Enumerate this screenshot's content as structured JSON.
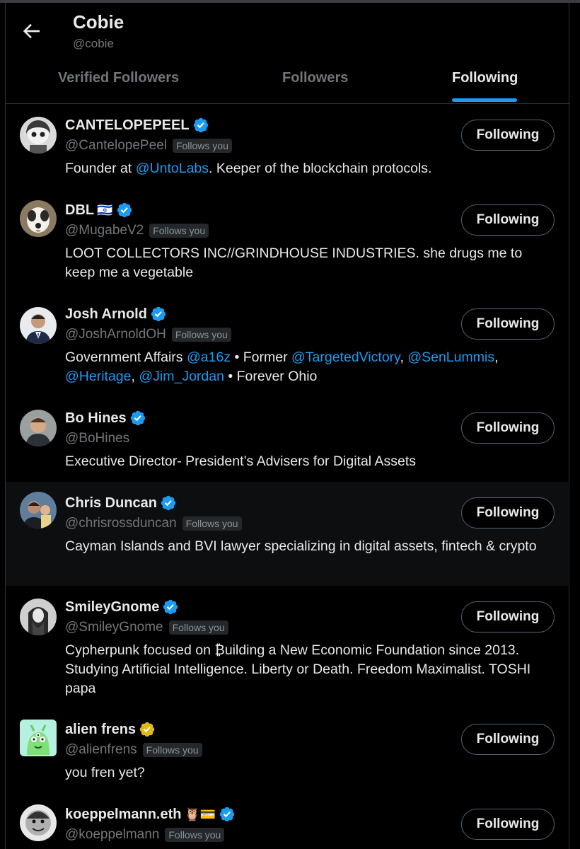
{
  "header": {
    "title": "Cobie",
    "handle": "@cobie",
    "tabs": [
      {
        "label": "Verified Followers"
      },
      {
        "label": "Followers"
      },
      {
        "label": "Following"
      }
    ]
  },
  "users": [
    {
      "name": "CANTELOPEPEEL",
      "handle": "@CantelopePeel",
      "follows_you": "Follows you",
      "button": "Following",
      "bio": [
        {
          "t": "Founder at "
        },
        {
          "link": "@UntoLabs"
        },
        {
          "t": ". Keeper of the blockchain protocols."
        }
      ]
    },
    {
      "name": "DBL",
      "emoji": "🇮🇱",
      "handle": "@MugabeV2",
      "follows_you": "Follows you",
      "button": "Following",
      "bio": [
        {
          "t": "LOOT COLLECTORS INC//GRINDHOUSE INDUSTRIES. she drugs me to keep me a vegetable"
        }
      ]
    },
    {
      "name": "Josh Arnold",
      "handle": "@JoshArnoldOH",
      "follows_you": "Follows you",
      "button": "Following",
      "bio": [
        {
          "t": "Government Affairs "
        },
        {
          "link": "@a16z"
        },
        {
          "t": " • Former "
        },
        {
          "link": "@TargetedVictory"
        },
        {
          "t": ", "
        },
        {
          "link": "@SenLummis"
        },
        {
          "t": ", "
        },
        {
          "link": "@Heritage"
        },
        {
          "t": ", "
        },
        {
          "link": "@Jim_Jordan"
        },
        {
          "t": " • Forever Ohio"
        }
      ]
    },
    {
      "name": "Bo Hines",
      "handle": "@BoHines",
      "follows_you": "",
      "button": "Following",
      "bio": [
        {
          "t": "Executive Director- President’s Advisers for Digital Assets"
        }
      ]
    },
    {
      "name": "Chris Duncan",
      "handle": "@chrisrossduncan",
      "follows_you": "Follows you",
      "button": "Following",
      "bio": [
        {
          "t": "Cayman Islands and BVI lawyer specializing in digital assets, fintech & crypto"
        }
      ]
    },
    {
      "name": "SmileyGnome",
      "handle": "@SmileyGnome",
      "follows_you": "Follows you",
      "button": "Following",
      "bio": [
        {
          "t": "Cypherpunk focused on ₿uilding a New Economic Foundation since 2013. Studying Artificial Intelligence. Liberty or Death. Freedom Maximalist. TOSHI papa"
        }
      ]
    },
    {
      "name": "alien frens",
      "handle": "@alienfrens",
      "follows_you": "Follows you",
      "button": "Following",
      "badge": "gold",
      "bio": [
        {
          "t": "you fren yet?"
        }
      ]
    },
    {
      "name": "koeppelmann.eth",
      "emoji": "🦉💳",
      "handle": "@koeppelmann",
      "follows_you": "Follows you",
      "button": "Following",
      "bio": []
    }
  ],
  "colors": {
    "accent": "#1d9bf0",
    "verified": "#1d9bf0",
    "gold": "#e2b719"
  }
}
